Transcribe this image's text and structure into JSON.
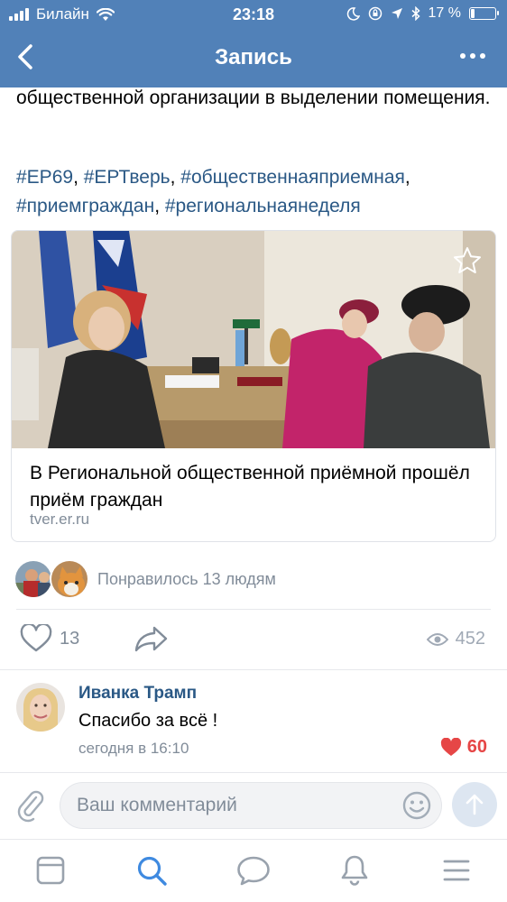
{
  "status_bar": {
    "carrier": "Билайн",
    "time": "23:18",
    "battery": "17 %",
    "battery_level": 0.17
  },
  "nav": {
    "title": "Запись",
    "back_icon": "chevron-left-icon",
    "more_icon": "more-dots-icon"
  },
  "post": {
    "text": "общественной организации в выделении помещения.",
    "hashtags": [
      "#ЕР69",
      "#ЕРТверь",
      "#общественнаяприемная",
      "#приемграждан",
      "#региональнаянеделя"
    ],
    "hashtag_separator": ", "
  },
  "link_card": {
    "title": "В Региональной общественной приёмной прошёл приём граждан",
    "domain": "tver.er.ru",
    "star_icon": "star-icon"
  },
  "likes": {
    "text": "Понравилось 13 людям"
  },
  "actions": {
    "like_count": "13",
    "views_count": "452"
  },
  "comment": {
    "author": "Иванка Трамп",
    "text": "Спасибо за всё !",
    "time": "сегодня в 16:10",
    "likes": "60"
  },
  "comment_input": {
    "placeholder": "Ваш комментарий"
  },
  "tabbar": {
    "items": [
      "news-icon",
      "search-icon",
      "messages-icon",
      "notifications-icon",
      "menu-icon"
    ],
    "active": "search-icon"
  },
  "colors": {
    "header": "#5181b8",
    "link": "#2a5885",
    "muted": "#818c99",
    "like_red": "#e64646",
    "tab_active": "#3f8ae0",
    "tab_inactive": "#99a2ad"
  }
}
